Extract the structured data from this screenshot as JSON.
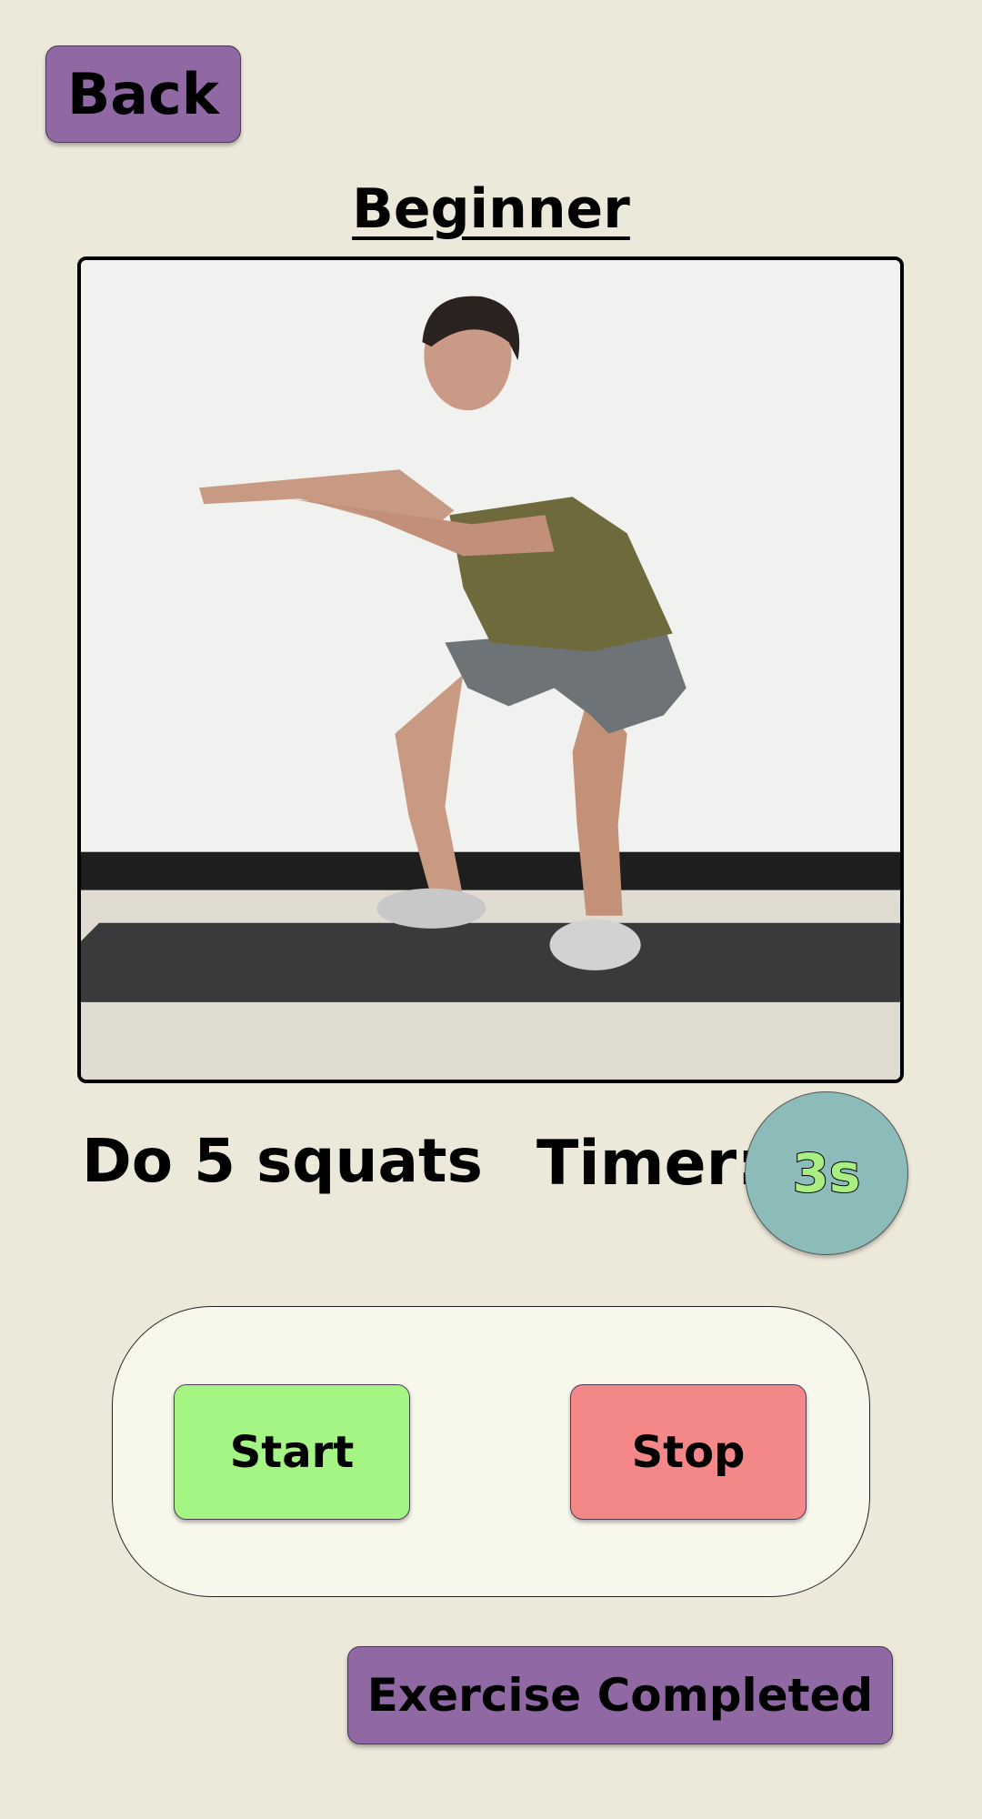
{
  "header": {
    "back_label": "Back",
    "title": "Beginner"
  },
  "exercise": {
    "image_name": "squat-demonstration",
    "instruction": "Do 5 squats"
  },
  "timer": {
    "label": "Timer:",
    "value": "3s"
  },
  "controls": {
    "start_label": "Start",
    "stop_label": "Stop"
  },
  "footer": {
    "completed_label": "Exercise Completed"
  },
  "colors": {
    "background": "#ece8da",
    "accent_purple": "#9069a4",
    "start_green": "#a4f584",
    "stop_red": "#f48787",
    "timer_teal": "#8cbcb9",
    "panel": "#f8f7ec"
  }
}
